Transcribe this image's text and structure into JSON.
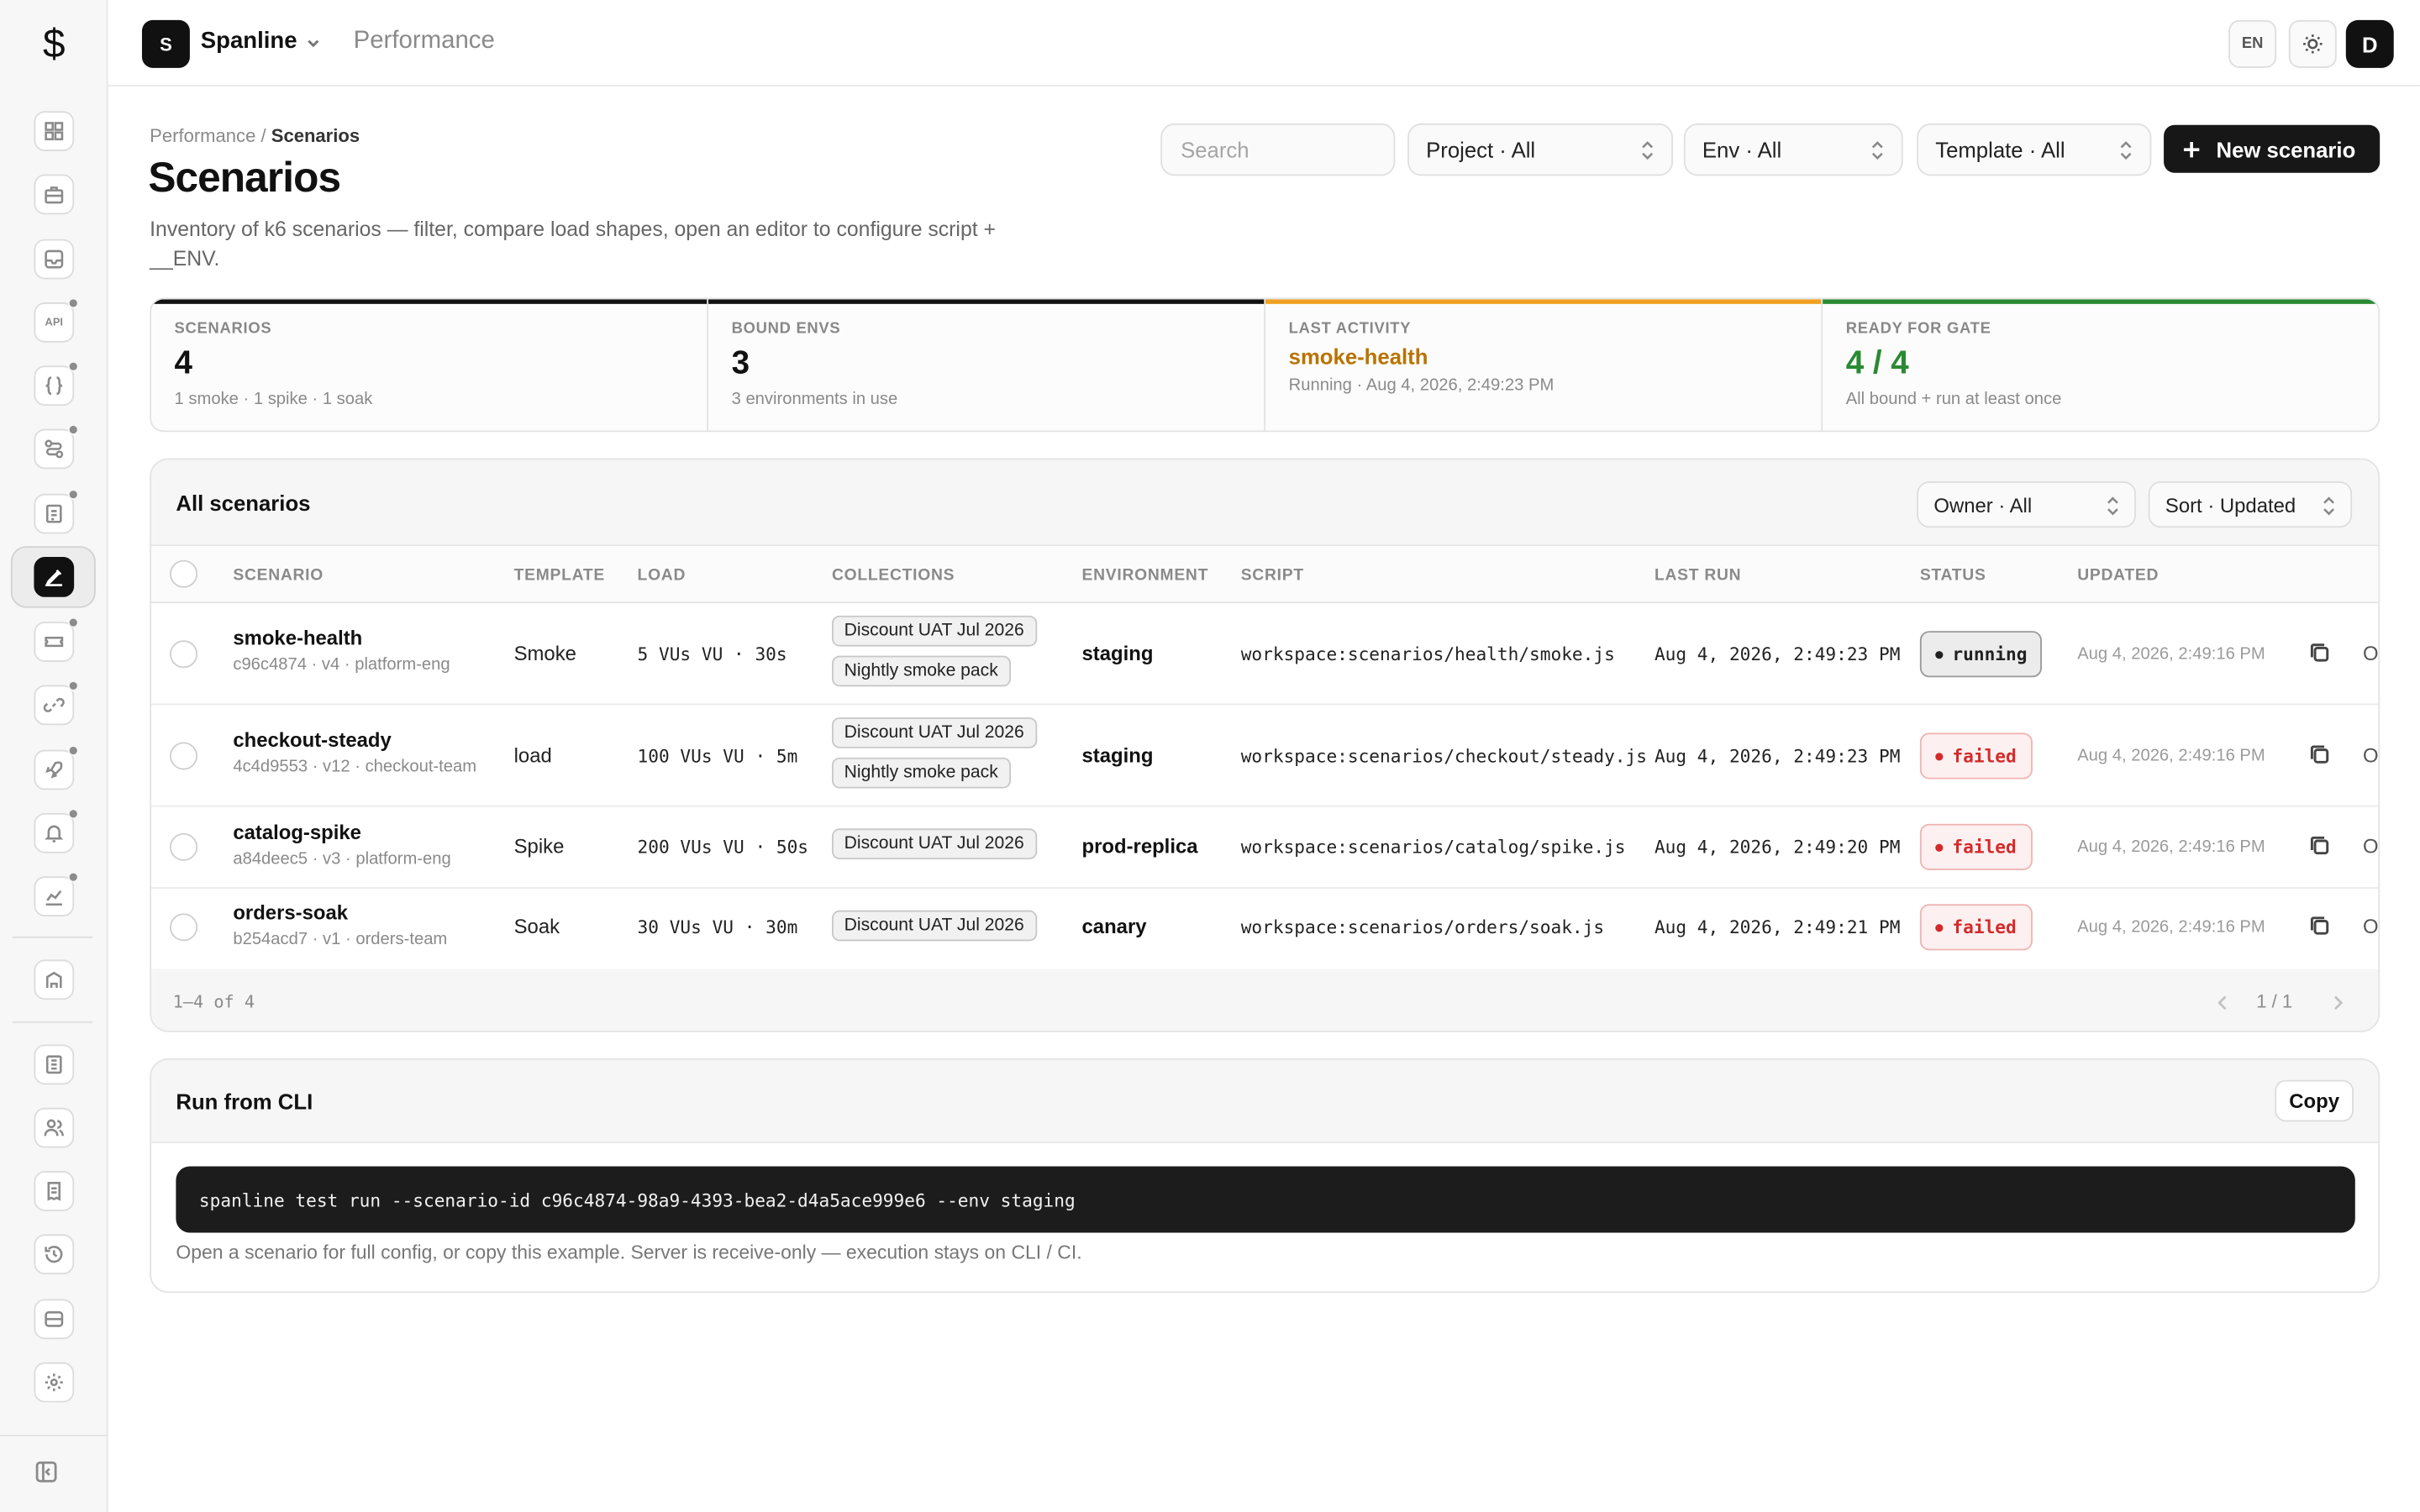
{
  "app": {
    "logo": "$",
    "org_initial": "S",
    "org_name": "Spanline",
    "section": "Performance"
  },
  "topbar": {
    "lang": "EN",
    "user_initial": "D"
  },
  "breadcrumb": {
    "parent": "Performance",
    "sep": " / ",
    "current": "Scenarios"
  },
  "page": {
    "title": "Scenarios",
    "description": "Inventory of k6 scenarios — filter, compare load shapes, open an editor to configure script + __ENV."
  },
  "filters": {
    "search_placeholder": "Search",
    "project": "Project · All",
    "env": "Env · All",
    "template": "Template · All",
    "new_button": "New scenario"
  },
  "stats": [
    {
      "label": "SCENARIOS",
      "value": "4",
      "sub": "1 smoke · 1 spike · 1 soak",
      "accent": "#111111"
    },
    {
      "label": "BOUND ENVS",
      "value": "3",
      "sub": "3 environments in use",
      "accent": "#111111"
    },
    {
      "label": "LAST ACTIVITY",
      "value": "smoke-health",
      "sub": "Running · Aug 4, 2026, 2:49:23 PM",
      "accent": "#f0a020"
    },
    {
      "label": "READY FOR GATE",
      "value": "4 / 4",
      "sub": "All bound + run at least once",
      "accent": "#2a8a32"
    }
  ],
  "table": {
    "title": "All scenarios",
    "owner_filter": "Owner · All",
    "sort": "Sort · Updated",
    "columns": [
      "SCENARIO",
      "TEMPLATE",
      "LOAD",
      "COLLECTIONS",
      "ENVIRONMENT",
      "SCRIPT",
      "LAST RUN",
      "STATUS",
      "UPDATED"
    ],
    "rows": [
      {
        "name": "smoke-health",
        "meta": "c96c4874 · v4 · platform-eng",
        "template": "Smoke",
        "load": "5 VUs VU · 30s",
        "collections": [
          "Discount UAT Jul 2026",
          "Nightly smoke pack"
        ],
        "environment": "staging",
        "script": "workspace:scenarios/health/smoke.js",
        "last_run": "Aug 4, 2026, 2:49:23 PM",
        "status": "running",
        "updated": "Aug 4, 2026, 2:49:16 PM",
        "open": "O"
      },
      {
        "name": "checkout-steady",
        "meta": "4c4d9553 · v12 · checkout-team",
        "template": "load",
        "load": "100 VUs VU · 5m",
        "collections": [
          "Discount UAT Jul 2026",
          "Nightly smoke pack"
        ],
        "environment": "staging",
        "script": "workspace:scenarios/checkout/steady.js",
        "last_run": "Aug 4, 2026, 2:49:23 PM",
        "status": "failed",
        "updated": "Aug 4, 2026, 2:49:16 PM",
        "open": "O"
      },
      {
        "name": "catalog-spike",
        "meta": "a84deec5 · v3 · platform-eng",
        "template": "Spike",
        "load": "200 VUs VU · 50s",
        "collections": [
          "Discount UAT Jul 2026"
        ],
        "environment": "prod-replica",
        "script": "workspace:scenarios/catalog/spike.js",
        "last_run": "Aug 4, 2026, 2:49:20 PM",
        "status": "failed",
        "updated": "Aug 4, 2026, 2:49:16 PM",
        "open": "O"
      },
      {
        "name": "orders-soak",
        "meta": "b254acd7 · v1 · orders-team",
        "template": "Soak",
        "load": "30 VUs VU · 30m",
        "collections": [
          "Discount UAT Jul 2026"
        ],
        "environment": "canary",
        "script": "workspace:scenarios/orders/soak.js",
        "last_run": "Aug 4, 2026, 2:49:21 PM",
        "status": "failed",
        "updated": "Aug 4, 2026, 2:49:16 PM",
        "open": "O"
      }
    ],
    "range": "1–4 of 4",
    "page": "1 / 1"
  },
  "cli": {
    "title": "Run from CLI",
    "copy_label": "Copy",
    "command": "spanline test run --scenario-id c96c4874-98a9-4393-bea2-d4a5ace999e6 --env staging",
    "note": "Open a scenario for full config, or copy this example. Server is receive-only — execution stays on CLI / CI."
  }
}
